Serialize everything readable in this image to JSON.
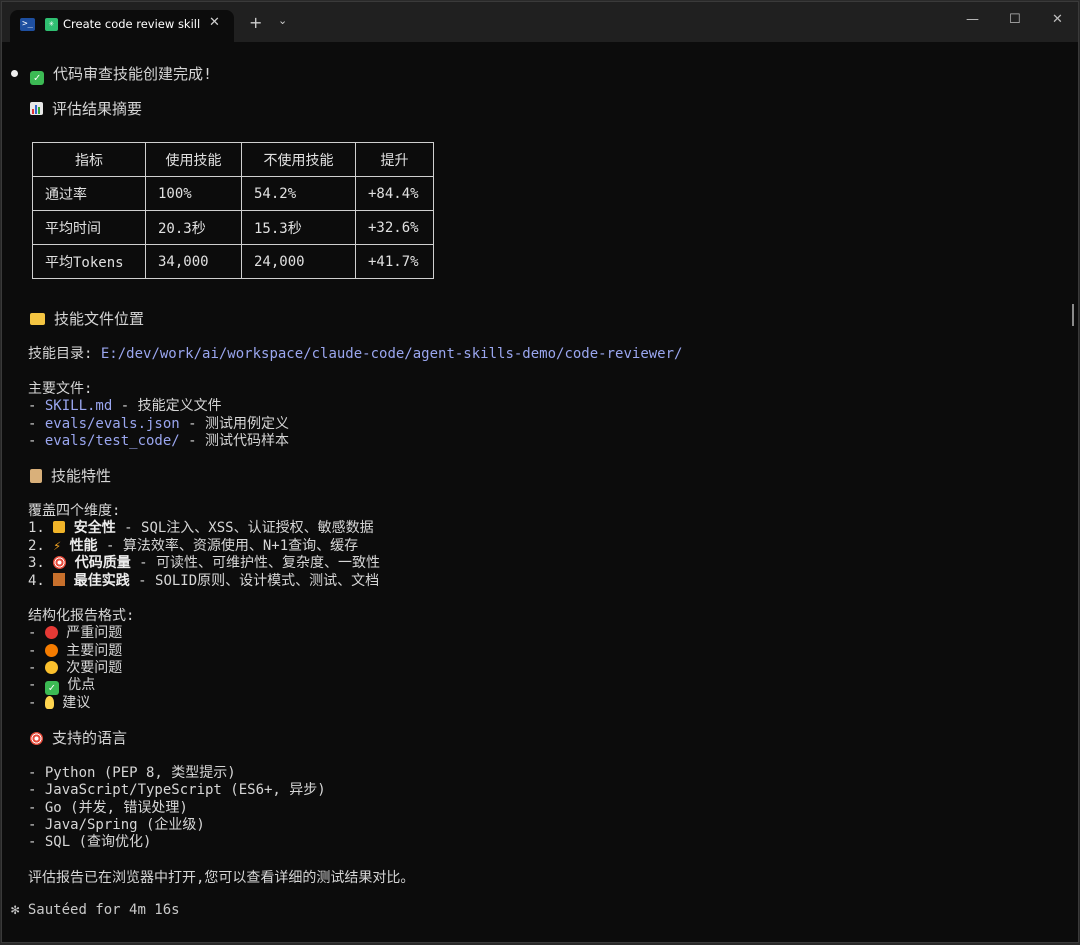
{
  "window": {
    "tab_title": "Create code review skill",
    "tab_close": "✕",
    "new_tab": "+",
    "dropdown": "⌄",
    "minimize": "—",
    "maximize": "☐",
    "close": "✕"
  },
  "output": {
    "completion": "代码审查技能创建完成!",
    "summary_heading": "评估结果摘要",
    "table": {
      "headers": [
        "指标",
        "使用技能",
        "不使用技能",
        "提升"
      ],
      "rows": [
        [
          "通过率",
          "100%",
          "54.2%",
          "+84.4%"
        ],
        [
          "平均时间",
          "20.3秒",
          "15.3秒",
          "+32.6%"
        ],
        [
          "平均Tokens",
          "34,000",
          "24,000",
          "+41.7%"
        ]
      ]
    },
    "location_heading": "技能文件位置",
    "dir_label": "技能目录:",
    "dir_path": "E:/dev/work/ai/workspace/claude-code/agent-skills-demo/code-reviewer/",
    "main_files_label": "主要文件:",
    "files": [
      {
        "name": "SKILL.md",
        "desc": " - 技能定义文件"
      },
      {
        "name": "evals/evals.json",
        "desc": " - 测试用例定义"
      },
      {
        "name": "evals/test_code/",
        "desc": " - 测试代码样本"
      }
    ],
    "features_heading": "技能特性",
    "dimensions_label": "覆盖四个维度:",
    "dimensions": [
      {
        "num": "1.",
        "name": "安全性",
        "desc": " - SQL注入、XSS、认证授权、敏感数据"
      },
      {
        "num": "2.",
        "name": "性能",
        "desc": " - 算法效率、资源使用、N+1查询、缓存"
      },
      {
        "num": "3.",
        "name": "代码质量",
        "desc": " - 可读性、可维护性、复杂度、一致性"
      },
      {
        "num": "4.",
        "name": "最佳实践",
        "desc": " - SOLID原则、设计模式、测试、文档"
      }
    ],
    "report_label": "结构化报告格式:",
    "report_items": [
      "严重问题",
      "主要问题",
      "次要问题",
      "优点",
      "建议"
    ],
    "languages_heading": "支持的语言",
    "languages": [
      "- Python (PEP 8, 类型提示)",
      "- JavaScript/TypeScript (ES6+, 异步)",
      "- Go (并发, 错误处理)",
      "- Java/Spring (企业级)",
      "- SQL (查询优化)"
    ],
    "closing": "评估报告已在浏览器中打开,您可以查看详细的测试结果对比。",
    "spinner": "✻",
    "status": "Sautéed for 4m 16s"
  },
  "colors": {
    "background": "#0c0c0c",
    "path": "#9aa6ef",
    "text": "#d6d6d6"
  }
}
